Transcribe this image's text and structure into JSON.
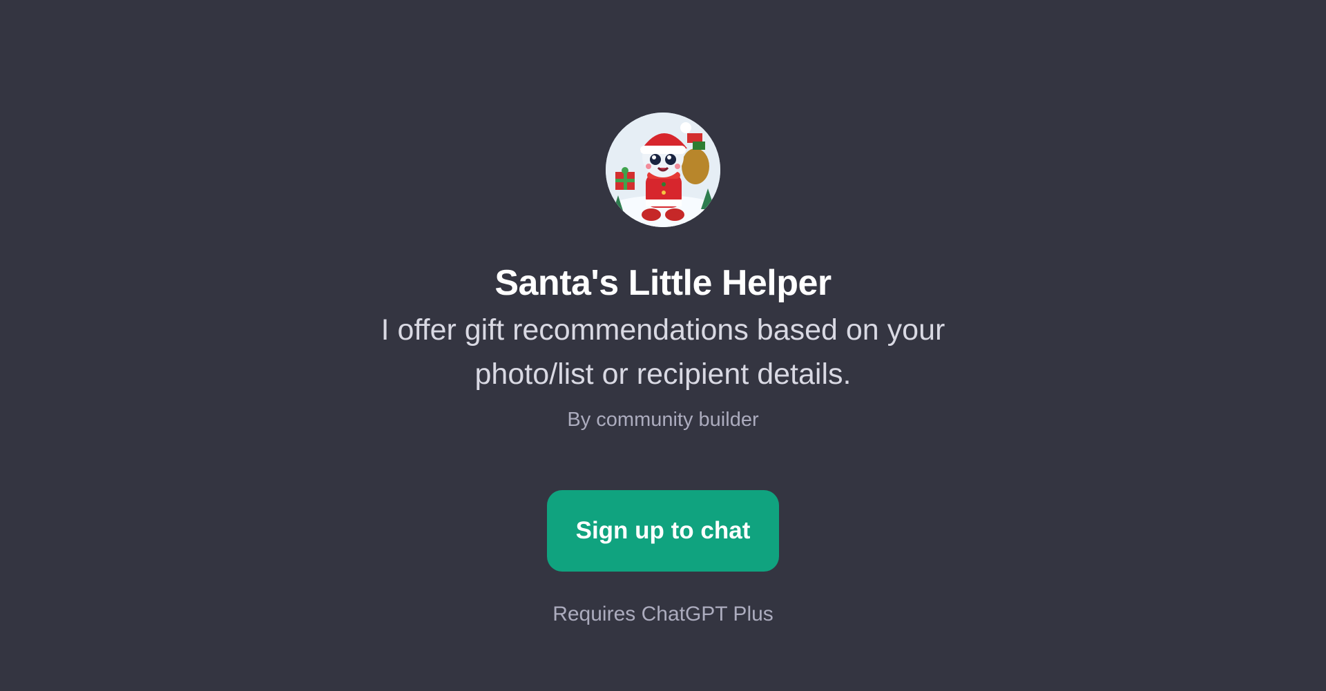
{
  "gpt": {
    "avatar_icon": "santa-robot-avatar-icon",
    "title": "Santa's Little Helper",
    "description": "I offer gift recommendations based on your photo/list or recipient details.",
    "author": "By community builder"
  },
  "cta": {
    "signup_label": "Sign up to chat",
    "requirement": "Requires ChatGPT Plus"
  },
  "colors": {
    "background": "#343541",
    "accent": "#10a37f"
  }
}
